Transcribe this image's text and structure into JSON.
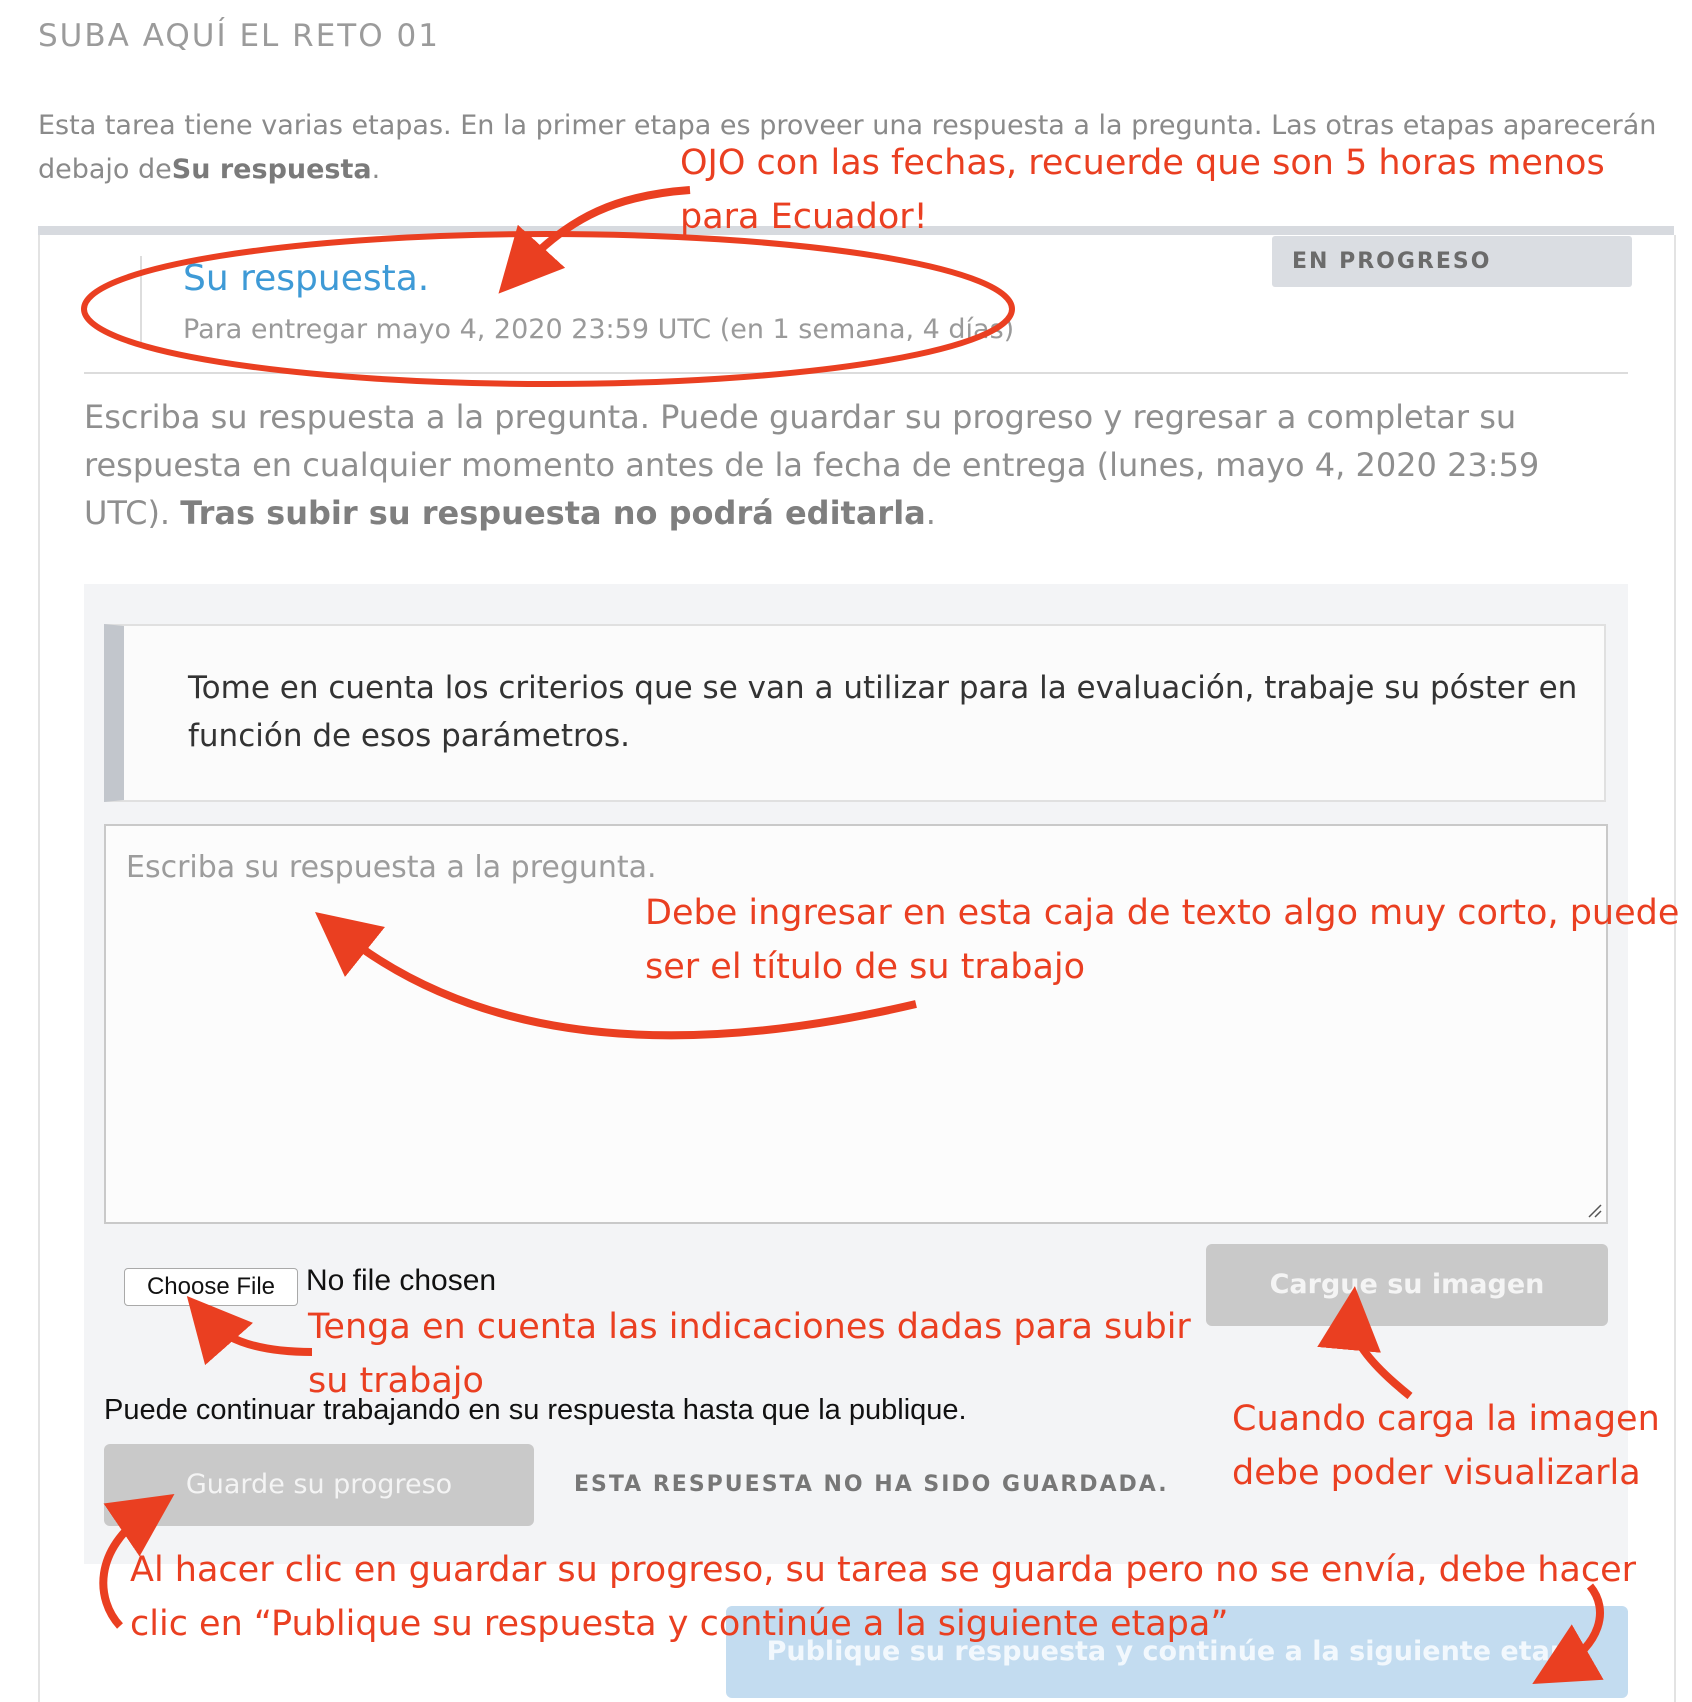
{
  "heading": "SUBA AQUÍ EL RETO 01",
  "intro": {
    "text": "Esta tarea tiene varias etapas. En la primer etapa es proveer una respuesta a la pregunta. Las otras etapas aparecerán debajo de",
    "bold": "Su respuesta",
    "end": "."
  },
  "step": {
    "title": "Su respuesta.",
    "due": "Para entregar mayo 4, 2020 23:59 UTC (en 1 semana, 4 días)",
    "status": "EN PROGRESO"
  },
  "instructions": {
    "text": "Escriba su respuesta a la pregunta. Puede guardar su progreso y regresar a completar su respuesta en cualquier momento antes de la fecha de entrega (lunes, mayo 4, 2020 23:59 UTC).",
    "bold": "Tras subir su respuesta no podrá editarla",
    "end": "."
  },
  "prompt": "Tome en cuenta los criterios que se van a utilizar para la evaluación, trabaje su póster en función de esos parámetros.",
  "answer": {
    "value": "",
    "placeholder": "Escriba su respuesta a la pregunta."
  },
  "file": {
    "button": "Choose File",
    "status": "No file chosen"
  },
  "upload_button": "Cargue su imagen",
  "continue_note": "Puede continuar trabajando en su respuesta hasta que la publique.",
  "save_button": "Guarde su progreso",
  "save_status": "ESTA RESPUESTA NO HA SIDO GUARDADA.",
  "publish_button": "Publique su respuesta y continúe a la siguiente etapa",
  "annotations": {
    "dates": "OJO con las fechas, recuerde que son 5 horas menos para Ecuador!",
    "textbox": "Debe ingresar en esta caja de texto algo muy corto, puede ser el título de su trabajo",
    "file": "Tenga en cuenta las indicaciones dadas para subir su trabajo",
    "image": "Cuando carga la imagen debe poder visualizarla",
    "save": "Al hacer clic en guardar su progreso, su tarea se guarda pero no se envía, debe hacer clic en “Publique su respuesta y continúe a la siguiente etapa”"
  },
  "colors": {
    "accent": "#3e9ad6",
    "annotation": "#ea3f21",
    "disabled_button": "#c9c9c9",
    "publish_button": "#c3dcf0"
  }
}
